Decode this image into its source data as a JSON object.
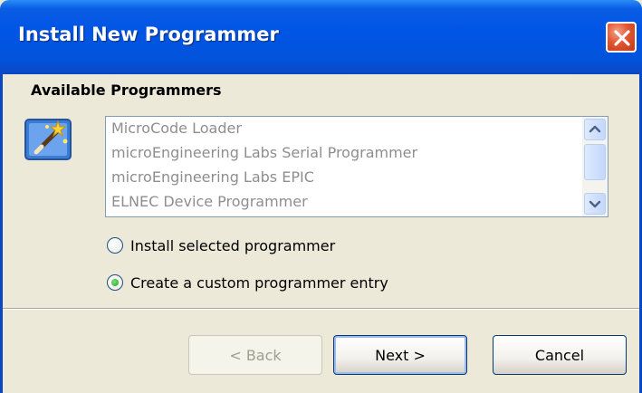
{
  "window": {
    "title": "Install New Programmer"
  },
  "section": {
    "title": "Available Programmers"
  },
  "programmers": {
    "items": [
      "MicroCode Loader",
      "microEngineering Labs Serial Programmer",
      "microEngineering Labs EPIC",
      "ELNEC Device Programmer"
    ]
  },
  "options": {
    "install_selected": {
      "label": "Install selected programmer",
      "checked": false
    },
    "create_custom": {
      "label": "Create a custom programmer entry",
      "checked": true
    }
  },
  "buttons": {
    "back": "< Back",
    "next": "Next >",
    "cancel": "Cancel"
  },
  "icons": {
    "close": "close-icon",
    "wizard": "wizard-icon",
    "scroll_up": "chevron-up-icon",
    "scroll_down": "chevron-down-icon"
  },
  "colors": {
    "titlebar": "#0055E5",
    "close_button": "#E2552F",
    "dialog_background": "#ECE9D8",
    "disabled_text": "#8E8E8E"
  }
}
